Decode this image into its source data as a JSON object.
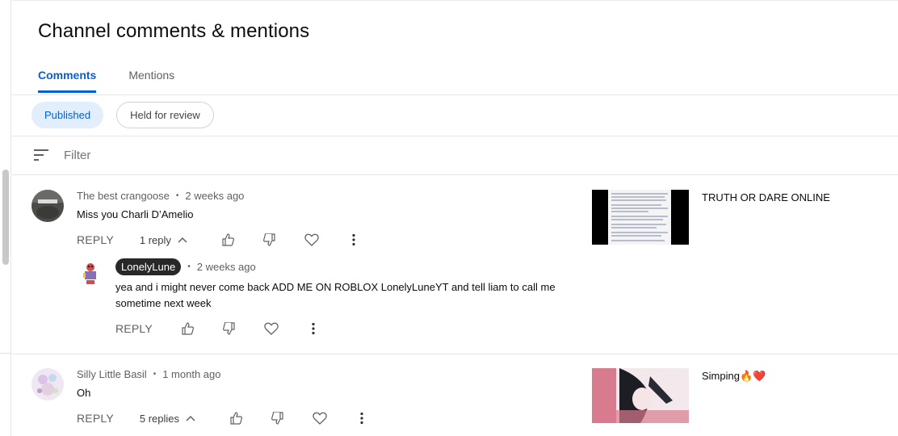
{
  "page": {
    "title": "Channel comments & mentions"
  },
  "tabs": [
    {
      "label": "Comments",
      "active": true
    },
    {
      "label": "Mentions",
      "active": false
    }
  ],
  "chips": [
    {
      "label": "Published",
      "selected": true
    },
    {
      "label": "Held for review",
      "selected": false
    }
  ],
  "filter": {
    "placeholder": "Filter",
    "icon": "filter-lines-icon"
  },
  "comments": [
    {
      "author": "The best crangoose",
      "time": "2 weeks ago",
      "text": "Miss you Charli D’Amelio",
      "reply_label": "REPLY",
      "replies_label": "1 reply",
      "video_title": "TRUTH OR DARE ONLINE",
      "replies": [
        {
          "author": "LonelyLune",
          "time": "2 weeks ago",
          "text_line1": "yea and i might never come back ADD ME ON ROBLOX LonelyLuneYT and tell liam to call me",
          "text_line2": "sometime next week",
          "reply_label": "REPLY"
        }
      ]
    },
    {
      "author": "Silly Little Basil",
      "time": "1 month ago",
      "text": "Oh",
      "reply_label": "REPLY",
      "replies_label": "5 replies",
      "video_title": "Simping🔥❤️"
    }
  ],
  "colors": {
    "accent": "#065fd4",
    "chip_bg": "#e3eefc",
    "pill_bg": "#282828"
  }
}
